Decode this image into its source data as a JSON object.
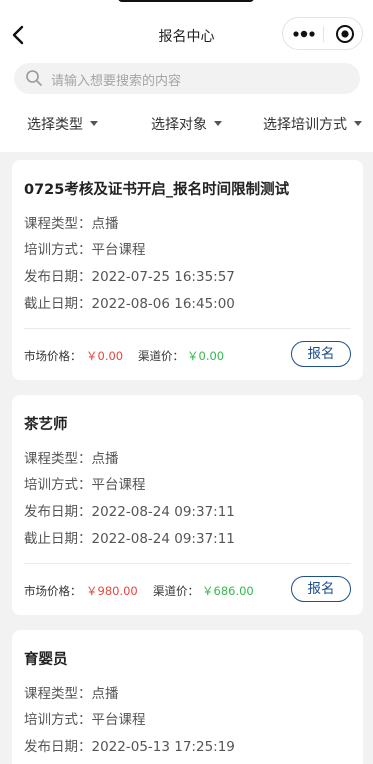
{
  "header": {
    "title": "报名中心"
  },
  "search": {
    "placeholder": "请输入想要搜索的内容"
  },
  "filters": [
    {
      "label": "选择类型"
    },
    {
      "label": "选择对象"
    },
    {
      "label": "选择培训方式"
    }
  ],
  "labels": {
    "course_type": "课程类型：",
    "training_mode": "培训方式：",
    "publish_date": "发布日期：",
    "deadline": "截止日期：",
    "market_price": "市场价格：",
    "channel_price": "渠道价：",
    "signup": "报名"
  },
  "courses": [
    {
      "name": "0725考核及证书开启_报名时间限制测试",
      "course_type": "点播",
      "training_mode": "平台课程",
      "publish_date": "2022-07-25 16:35:57",
      "deadline": "2022-08-06 16:45:00",
      "market_price": "￥0.00",
      "channel_price": "￥0.00"
    },
    {
      "name": "茶艺师",
      "course_type": "点播",
      "training_mode": "平台课程",
      "publish_date": "2022-08-24 09:37:11",
      "deadline": "2022-08-24 09:37:11",
      "market_price": "￥980.00",
      "channel_price": "￥686.00"
    },
    {
      "name": "育婴员",
      "course_type": "点播",
      "training_mode": "平台课程",
      "publish_date": "2022-05-13 17:25:19"
    }
  ],
  "colors": {
    "market_price": "#e8473d",
    "channel_price": "#36b84e",
    "signup_button": "#1d4f8c"
  },
  "icons": [
    "back-arrow-icon",
    "more-dots-icon",
    "target-icon",
    "search-icon",
    "caret-down-icon"
  ]
}
